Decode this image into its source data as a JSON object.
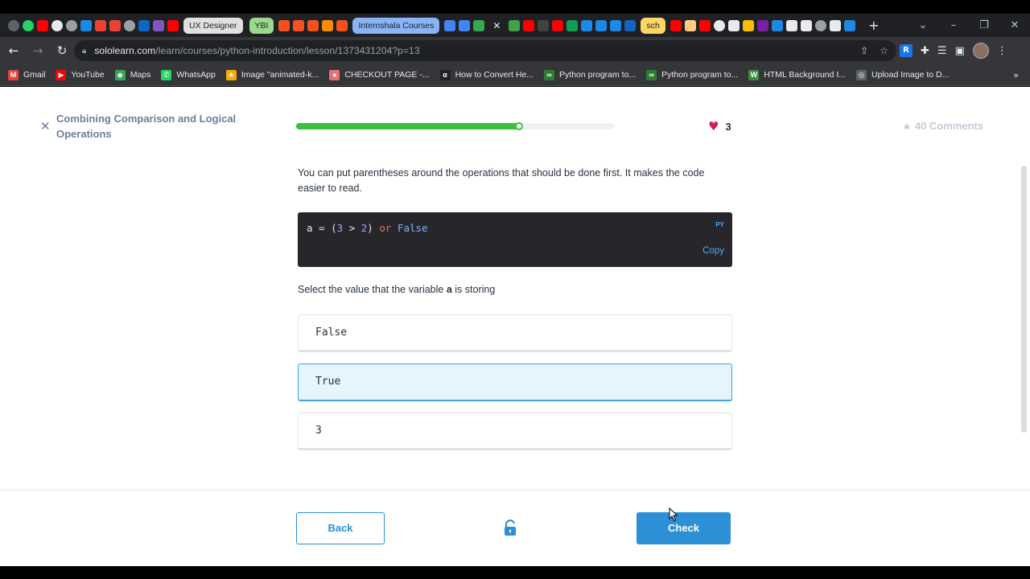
{
  "browser": {
    "tabs": [
      {
        "label": "UX Designer",
        "color": "#e0e0e0"
      },
      {
        "label": "YBI",
        "color": "#9bd88c"
      },
      {
        "label": "Internshala Courses",
        "color": "#8ab4f8"
      },
      {
        "label": "sch",
        "color": "#fdd663"
      }
    ],
    "url_host": "sololearn.com",
    "url_path": "/learn/courses/python-introduction/lesson/1373431204?p=13",
    "bookmarks": [
      {
        "label": "Gmail",
        "color": "#ea4335",
        "icon": "M"
      },
      {
        "label": "YouTube",
        "color": "#ff0000",
        "icon": "▶"
      },
      {
        "label": "Maps",
        "color": "#34a853",
        "icon": "◆"
      },
      {
        "label": "WhatsApp",
        "color": "#25d366",
        "icon": "✆"
      },
      {
        "label": "Image \"animated-k...",
        "color": "#f9ab00",
        "icon": "★"
      },
      {
        "label": "CHECKOUT PAGE -...",
        "color": "#e57373",
        "icon": "●"
      },
      {
        "label": "How to Convert He...",
        "color": "#202124",
        "icon": "α"
      },
      {
        "label": "Python program to...",
        "color": "#2e7d32",
        "icon": "∞"
      },
      {
        "label": "Python program to...",
        "color": "#2e7d32",
        "icon": "∞"
      },
      {
        "label": "HTML Background I...",
        "color": "#388e3c",
        "icon": "W"
      },
      {
        "label": "Upload Image to D...",
        "color": "#5f6368",
        "icon": "◎"
      }
    ],
    "bookmarks_more": "»"
  },
  "lesson": {
    "close_icon": "✕",
    "title": "Combining Comparison and Logical Operations",
    "progress_percent": 70,
    "hearts": "3",
    "comments": "40 Comments"
  },
  "content": {
    "intro": "You can put parentheses around the operations that should be done first. It makes the code easier to read.",
    "code": {
      "language": "PY",
      "copy_label": "Copy",
      "tokens": {
        "var": "a = (",
        "n1": "3",
        "op": " > ",
        "n2": "2",
        "close": ") ",
        "kw": "or",
        "sp": " ",
        "const": "False"
      }
    },
    "question_prefix": "Select the value that the variable ",
    "question_var": "a",
    "question_suffix": " is storing",
    "options": [
      {
        "label": "False",
        "selected": false
      },
      {
        "label": "True",
        "selected": true
      },
      {
        "label": "3",
        "selected": false
      }
    ]
  },
  "footer": {
    "back_label": "Back",
    "check_label": "Check"
  },
  "colors": {
    "accent": "#2d8fd5",
    "progress": "#3cc13b",
    "heart": "#d81b60",
    "selected_bg": "#e4f5fd"
  }
}
